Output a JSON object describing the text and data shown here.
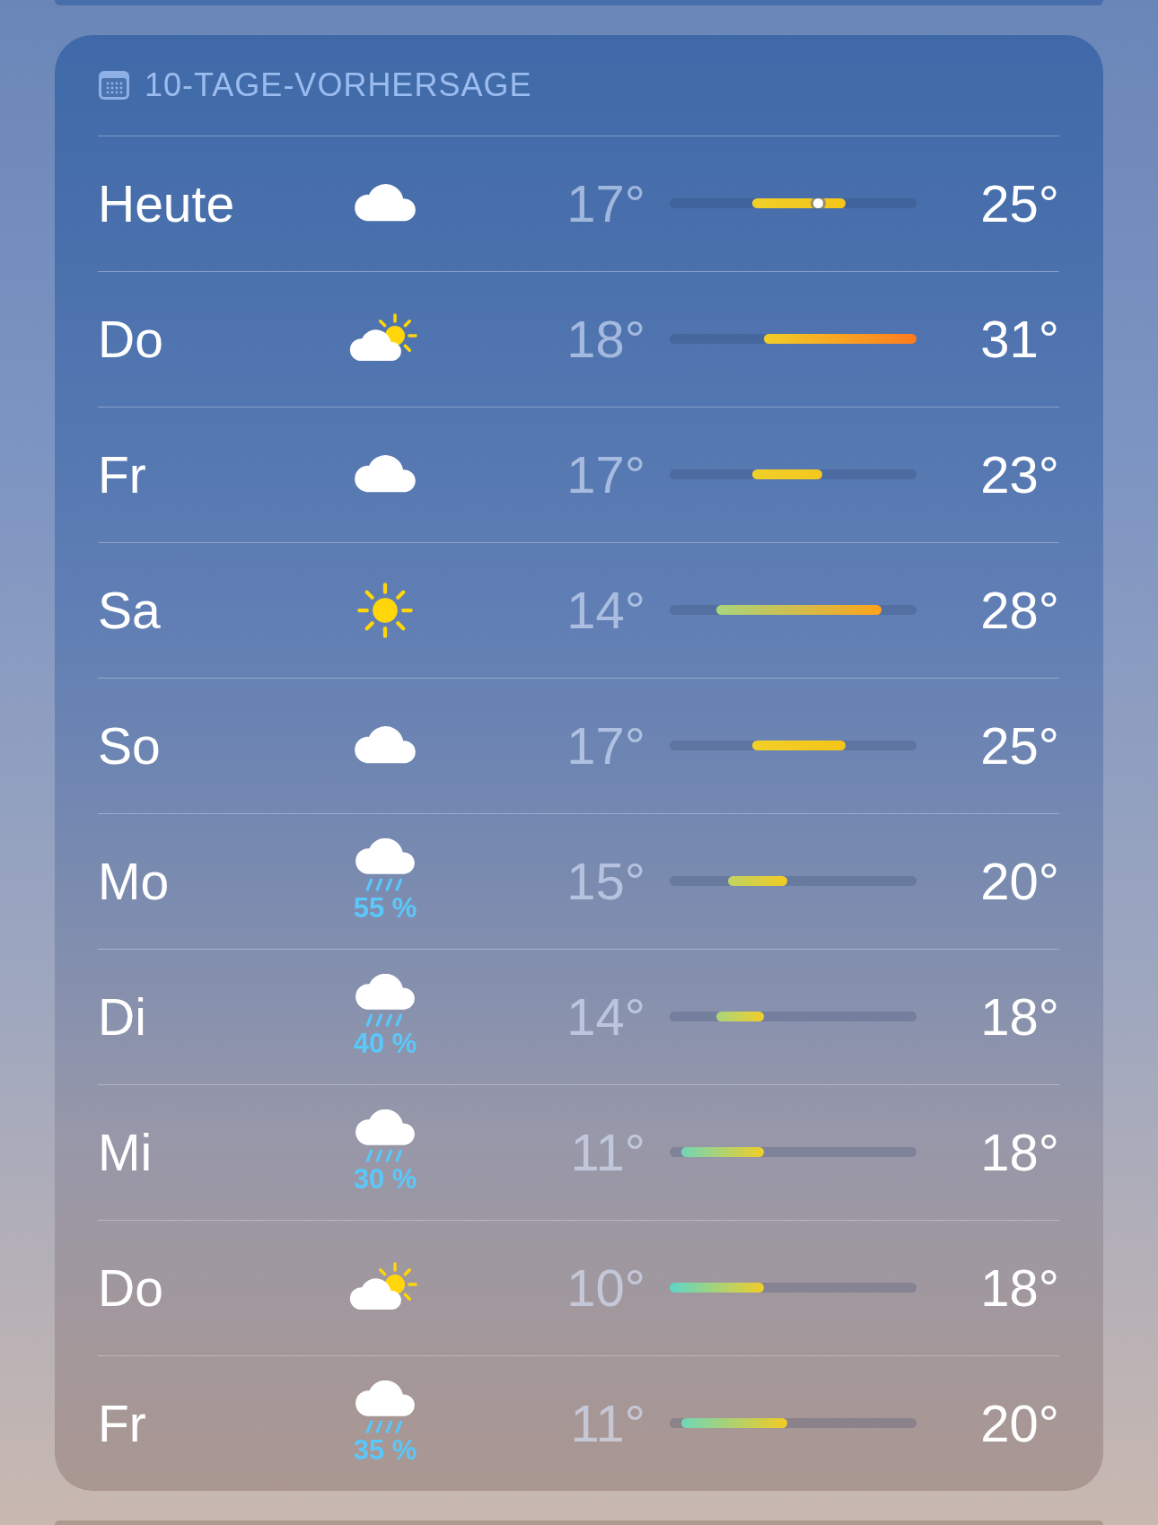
{
  "header": {
    "title": "10-TAGE-VORHERSAGE"
  },
  "days": [
    {
      "day": "Heute",
      "kind": "cloud",
      "low": "17°",
      "high": "25°",
      "now_marker": {
        "level": 0.6
      }
    },
    {
      "day": "Do",
      "kind": "sun-cloud",
      "low": "18°",
      "high": "31°"
    },
    {
      "day": "Fr",
      "kind": "cloud",
      "low": "17°",
      "high": "23°"
    },
    {
      "day": "Sa",
      "kind": "sun",
      "low": "14°",
      "high": "28°"
    },
    {
      "day": "So",
      "kind": "cloud",
      "low": "17°",
      "high": "25°"
    },
    {
      "day": "Mo",
      "kind": "rain",
      "precipitation": "55 %",
      "low": "15°",
      "high": "20°"
    },
    {
      "day": "Di",
      "kind": "rain",
      "precipitation": "40 %",
      "low": "14°",
      "high": "18°"
    },
    {
      "day": "Mi",
      "kind": "rain",
      "precipitation": "30 %",
      "low": "11°",
      "high": "18°"
    },
    {
      "day": "Do",
      "kind": "sun-cloud",
      "low": "10°",
      "high": "18°"
    },
    {
      "day": "Fr",
      "kind": "rain",
      "precipitation": "35 %",
      "low": "11°",
      "high": "20°"
    }
  ]
}
